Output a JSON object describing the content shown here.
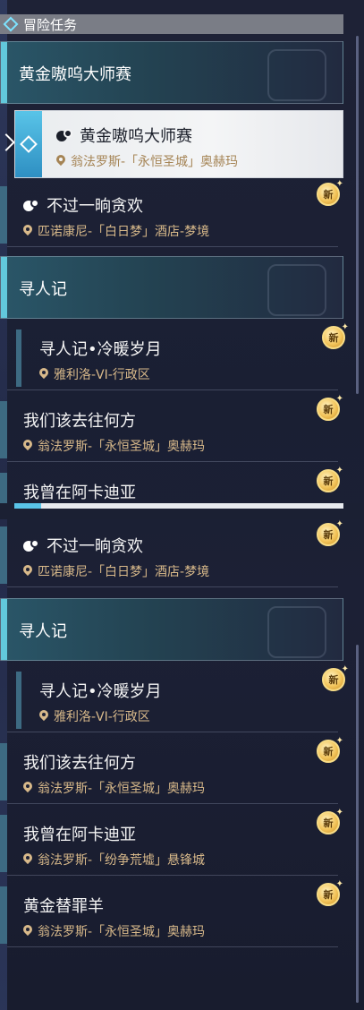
{
  "header": {
    "title": "冒险任务"
  },
  "panel1": {
    "category1": {
      "label": "黄金嗷呜大师赛"
    },
    "selected": {
      "name": "黄金嗷呜大师赛",
      "location": "翁法罗斯-「永恒圣城」奥赫玛"
    },
    "item1": {
      "name": "不过一晌贪欢",
      "location": "匹诺康尼-「白日梦」酒店-梦境",
      "badge": "新"
    },
    "category2": {
      "label": "寻人记"
    },
    "item2": {
      "name": "寻人记•冷暖岁月",
      "location": "雅利洛-VI-行政区",
      "badge": "新"
    },
    "item3": {
      "name": "我们该去往何方",
      "location": "翁法罗斯-「永恒圣城」奥赫玛",
      "badge": "新"
    },
    "item4": {
      "name": "我曾在阿卡迪亚",
      "badge": "新"
    }
  },
  "panel2": {
    "item1": {
      "name": "不过一晌贪欢",
      "location": "匹诺康尼-「白日梦」酒店-梦境",
      "badge": "新"
    },
    "category": {
      "label": "寻人记"
    },
    "item2": {
      "name": "寻人记•冷暖岁月",
      "location": "雅利洛-VI-行政区",
      "badge": "新"
    },
    "item3": {
      "name": "我们该去往何方",
      "location": "翁法罗斯-「永恒圣城」奥赫玛",
      "badge": "新"
    },
    "item4": {
      "name": "我曾在阿卡迪亚",
      "location": "翁法罗斯-「纷争荒墟」悬锋城",
      "badge": "新"
    },
    "item5": {
      "name": "黄金替罪羊",
      "location": "翁法罗斯-「永恒圣城」奥赫玛",
      "badge": "新"
    }
  }
}
